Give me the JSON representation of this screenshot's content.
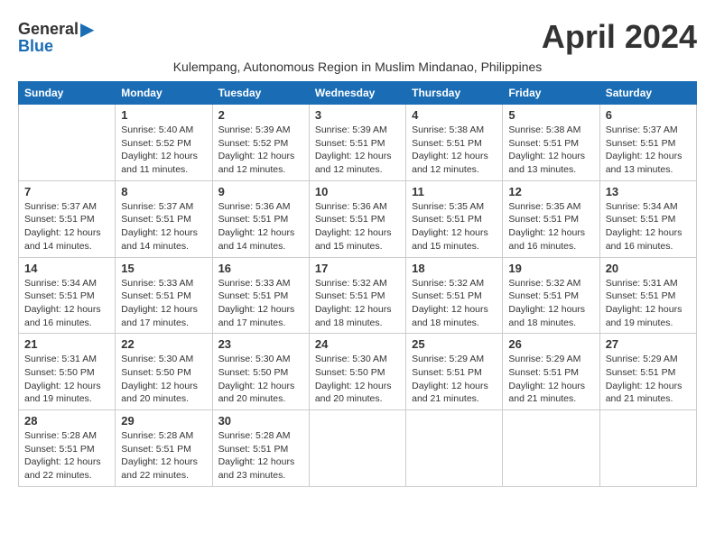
{
  "header": {
    "logo_general": "General",
    "logo_blue": "Blue",
    "title": "April 2024",
    "subtitle": "Kulempang, Autonomous Region in Muslim Mindanao, Philippines"
  },
  "weekdays": [
    "Sunday",
    "Monday",
    "Tuesday",
    "Wednesday",
    "Thursday",
    "Friday",
    "Saturday"
  ],
  "weeks": [
    [
      {
        "day": "",
        "info": ""
      },
      {
        "day": "1",
        "info": "Sunrise: 5:40 AM\nSunset: 5:52 PM\nDaylight: 12 hours\nand 11 minutes."
      },
      {
        "day": "2",
        "info": "Sunrise: 5:39 AM\nSunset: 5:52 PM\nDaylight: 12 hours\nand 12 minutes."
      },
      {
        "day": "3",
        "info": "Sunrise: 5:39 AM\nSunset: 5:51 PM\nDaylight: 12 hours\nand 12 minutes."
      },
      {
        "day": "4",
        "info": "Sunrise: 5:38 AM\nSunset: 5:51 PM\nDaylight: 12 hours\nand 12 minutes."
      },
      {
        "day": "5",
        "info": "Sunrise: 5:38 AM\nSunset: 5:51 PM\nDaylight: 12 hours\nand 13 minutes."
      },
      {
        "day": "6",
        "info": "Sunrise: 5:37 AM\nSunset: 5:51 PM\nDaylight: 12 hours\nand 13 minutes."
      }
    ],
    [
      {
        "day": "7",
        "info": "Sunrise: 5:37 AM\nSunset: 5:51 PM\nDaylight: 12 hours\nand 14 minutes."
      },
      {
        "day": "8",
        "info": "Sunrise: 5:37 AM\nSunset: 5:51 PM\nDaylight: 12 hours\nand 14 minutes."
      },
      {
        "day": "9",
        "info": "Sunrise: 5:36 AM\nSunset: 5:51 PM\nDaylight: 12 hours\nand 14 minutes."
      },
      {
        "day": "10",
        "info": "Sunrise: 5:36 AM\nSunset: 5:51 PM\nDaylight: 12 hours\nand 15 minutes."
      },
      {
        "day": "11",
        "info": "Sunrise: 5:35 AM\nSunset: 5:51 PM\nDaylight: 12 hours\nand 15 minutes."
      },
      {
        "day": "12",
        "info": "Sunrise: 5:35 AM\nSunset: 5:51 PM\nDaylight: 12 hours\nand 16 minutes."
      },
      {
        "day": "13",
        "info": "Sunrise: 5:34 AM\nSunset: 5:51 PM\nDaylight: 12 hours\nand 16 minutes."
      }
    ],
    [
      {
        "day": "14",
        "info": "Sunrise: 5:34 AM\nSunset: 5:51 PM\nDaylight: 12 hours\nand 16 minutes."
      },
      {
        "day": "15",
        "info": "Sunrise: 5:33 AM\nSunset: 5:51 PM\nDaylight: 12 hours\nand 17 minutes."
      },
      {
        "day": "16",
        "info": "Sunrise: 5:33 AM\nSunset: 5:51 PM\nDaylight: 12 hours\nand 17 minutes."
      },
      {
        "day": "17",
        "info": "Sunrise: 5:32 AM\nSunset: 5:51 PM\nDaylight: 12 hours\nand 18 minutes."
      },
      {
        "day": "18",
        "info": "Sunrise: 5:32 AM\nSunset: 5:51 PM\nDaylight: 12 hours\nand 18 minutes."
      },
      {
        "day": "19",
        "info": "Sunrise: 5:32 AM\nSunset: 5:51 PM\nDaylight: 12 hours\nand 18 minutes."
      },
      {
        "day": "20",
        "info": "Sunrise: 5:31 AM\nSunset: 5:51 PM\nDaylight: 12 hours\nand 19 minutes."
      }
    ],
    [
      {
        "day": "21",
        "info": "Sunrise: 5:31 AM\nSunset: 5:50 PM\nDaylight: 12 hours\nand 19 minutes."
      },
      {
        "day": "22",
        "info": "Sunrise: 5:30 AM\nSunset: 5:50 PM\nDaylight: 12 hours\nand 20 minutes."
      },
      {
        "day": "23",
        "info": "Sunrise: 5:30 AM\nSunset: 5:50 PM\nDaylight: 12 hours\nand 20 minutes."
      },
      {
        "day": "24",
        "info": "Sunrise: 5:30 AM\nSunset: 5:50 PM\nDaylight: 12 hours\nand 20 minutes."
      },
      {
        "day": "25",
        "info": "Sunrise: 5:29 AM\nSunset: 5:51 PM\nDaylight: 12 hours\nand 21 minutes."
      },
      {
        "day": "26",
        "info": "Sunrise: 5:29 AM\nSunset: 5:51 PM\nDaylight: 12 hours\nand 21 minutes."
      },
      {
        "day": "27",
        "info": "Sunrise: 5:29 AM\nSunset: 5:51 PM\nDaylight: 12 hours\nand 21 minutes."
      }
    ],
    [
      {
        "day": "28",
        "info": "Sunrise: 5:28 AM\nSunset: 5:51 PM\nDaylight: 12 hours\nand 22 minutes."
      },
      {
        "day": "29",
        "info": "Sunrise: 5:28 AM\nSunset: 5:51 PM\nDaylight: 12 hours\nand 22 minutes."
      },
      {
        "day": "30",
        "info": "Sunrise: 5:28 AM\nSunset: 5:51 PM\nDaylight: 12 hours\nand 23 minutes."
      },
      {
        "day": "",
        "info": ""
      },
      {
        "day": "",
        "info": ""
      },
      {
        "day": "",
        "info": ""
      },
      {
        "day": "",
        "info": ""
      }
    ]
  ]
}
